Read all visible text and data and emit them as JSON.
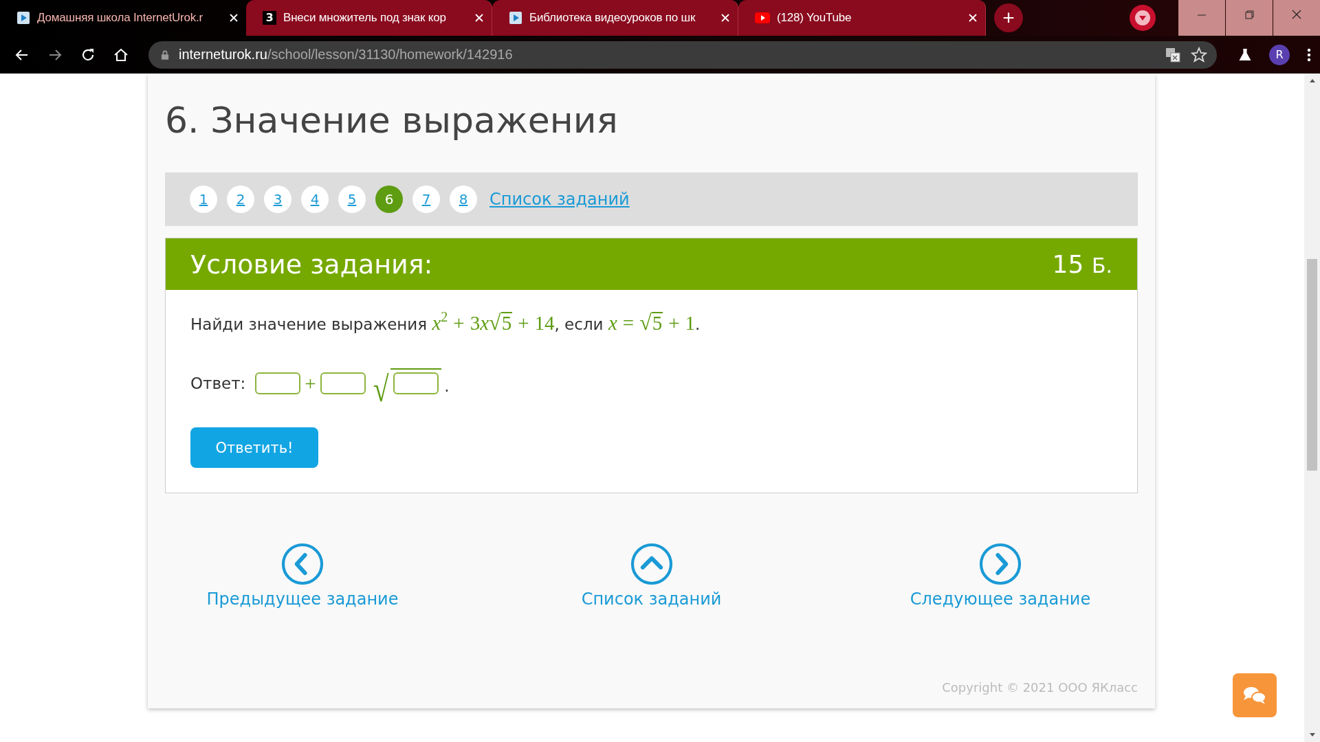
{
  "browser": {
    "tabs": [
      {
        "title": "Домашняя школа InternetUrok.r",
        "kind": "video",
        "selected": true
      },
      {
        "title": "Внеси множитель под знак кор",
        "kind": "letter",
        "icon_text": "З",
        "selected": false
      },
      {
        "title": "Библиотека видеоуроков по шк",
        "kind": "video",
        "selected": false
      },
      {
        "title": "(128) YouTube",
        "kind": "play",
        "selected": false
      }
    ],
    "new_tab": "+",
    "address": {
      "host": "interneturok.ru",
      "path": "/school/lesson/31130/homework/142916"
    },
    "profile": "R"
  },
  "page": {
    "title": "6. Значение выражения",
    "pager": [
      {
        "label": "1",
        "selected": false
      },
      {
        "label": "2",
        "selected": false
      },
      {
        "label": "3",
        "selected": false
      },
      {
        "label": "4",
        "selected": false
      },
      {
        "label": "5",
        "selected": false
      },
      {
        "label": "6",
        "selected": true
      },
      {
        "label": "7",
        "selected": false
      },
      {
        "label": "8",
        "selected": false
      }
    ],
    "task_list_link": "Список заданий",
    "condition": {
      "heading": "Условие задания:",
      "points": "15",
      "points_unit": "Б.",
      "problem": [
        {
          "kind": "text",
          "text": "Найди значение выражения "
        },
        {
          "kind": "var",
          "text": "x"
        },
        {
          "kind": "sup",
          "text": "2"
        },
        {
          "kind": "op",
          "text": "+"
        },
        {
          "kind": "num",
          "text": "3"
        },
        {
          "kind": "var",
          "text": "x"
        },
        {
          "kind": "sqrt",
          "radical": "√",
          "text": "5"
        },
        {
          "kind": "op",
          "text": "+"
        },
        {
          "kind": "num",
          "text": "14"
        },
        {
          "kind": "text",
          "text": ", если "
        },
        {
          "kind": "var",
          "text": "x"
        },
        {
          "kind": "op",
          "text": "="
        },
        {
          "kind": "sqrt",
          "radical": "√",
          "text": "5"
        },
        {
          "kind": "op",
          "text": "+"
        },
        {
          "kind": "num",
          "text": "1"
        },
        {
          "kind": "text",
          "text": "."
        }
      ],
      "answer_label": "Ответ:",
      "answer": [
        {
          "kind": "field"
        },
        {
          "kind": "op",
          "text": "+"
        },
        {
          "kind": "field"
        },
        {
          "kind": "sqrt_field",
          "radical": "√"
        },
        {
          "kind": "text",
          "text": "."
        }
      ],
      "submit": "Ответить!"
    },
    "nav": [
      {
        "kind": "prev",
        "label": "Предыдущее задание"
      },
      {
        "kind": "up",
        "label": "Список заданий"
      },
      {
        "kind": "next",
        "label": "Следующее задание"
      }
    ],
    "copyright": "Copyright © 2021 ООО ЯКласс"
  }
}
